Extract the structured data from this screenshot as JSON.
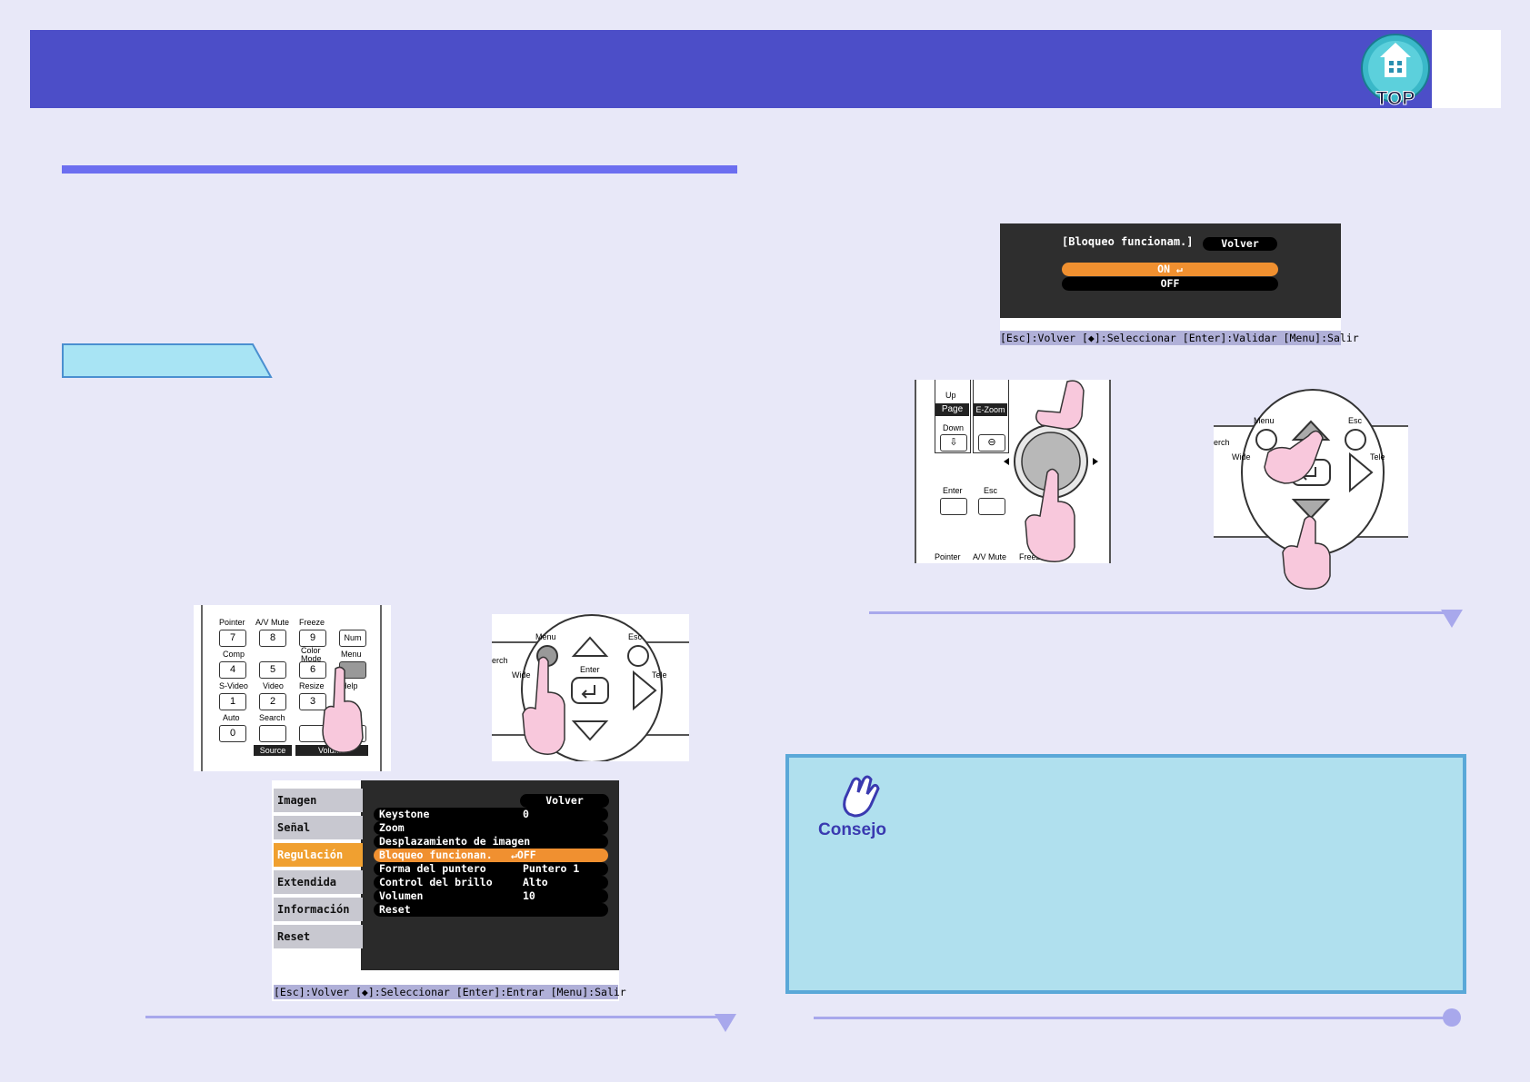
{
  "header": {
    "top_button_label": "TOP",
    "top_button_icon": "home-icon"
  },
  "procedure_tag": {
    "label": ""
  },
  "menu_remote_left": {
    "labels": [
      "Pointer",
      "A/V Mute",
      "Freeze",
      "Num",
      "Comp",
      "Color Mode",
      "Menu",
      "S-Video",
      "Video",
      "Resize",
      "Help",
      "Auto",
      "Search",
      "Source",
      "Volume"
    ],
    "keys": [
      "7",
      "8",
      "9",
      "4",
      "5",
      "6",
      "1",
      "2",
      "3",
      "0"
    ]
  },
  "menu_panel_right": {
    "labels": [
      "Menu",
      "Esc",
      "Enter",
      "Wide",
      "Tele",
      "erch"
    ]
  },
  "main_menu": {
    "volver": "Volver",
    "sidebar": [
      "Imagen",
      "Señal",
      "Regulación",
      "Extendida",
      "Información",
      "Reset"
    ],
    "active_index": 2,
    "rows": [
      {
        "label": "Keystone",
        "value": "0"
      },
      {
        "label": "Zoom",
        "value": ""
      },
      {
        "label": "Desplazamiento de imagen",
        "value": ""
      },
      {
        "label": "Bloqueo funcionan.",
        "value": "↵OFF"
      },
      {
        "label": "Forma del puntero",
        "value": "Puntero 1"
      },
      {
        "label": "Control del brillo",
        "value": "Alto"
      },
      {
        "label": "Volumen",
        "value": " 10"
      },
      {
        "label": "Reset",
        "value": ""
      }
    ],
    "selected_row": 3,
    "status": "[Esc]:Volver [◆]:Seleccionar [Enter]:Entrar   [Menu]:Salir"
  },
  "sub_menu": {
    "title": "[Bloqueo funcionam.]",
    "volver": "Volver",
    "option_on": "ON  ↵",
    "option_off": "OFF",
    "status": "[Esc]:Volver [◆]:Seleccionar [Enter]:Validar  [Menu]:Salir"
  },
  "select_remote_left": {
    "labels": [
      "Up",
      "Page",
      "E-Zoom",
      "Down",
      "Enter",
      "Esc",
      "Pointer",
      "A/V Mute",
      "Freeze"
    ]
  },
  "select_panel_right": {
    "labels": [
      "Menu",
      "Esc",
      "Wide",
      "Tele",
      "erch",
      "nter"
    ]
  },
  "tip": {
    "label": "Consejo",
    "icon": "pointing-hand-icon"
  },
  "colors": {
    "header": "#4c4ec8",
    "menu_highlight": "#f09030",
    "tip_bg": "#b0e0ee"
  }
}
